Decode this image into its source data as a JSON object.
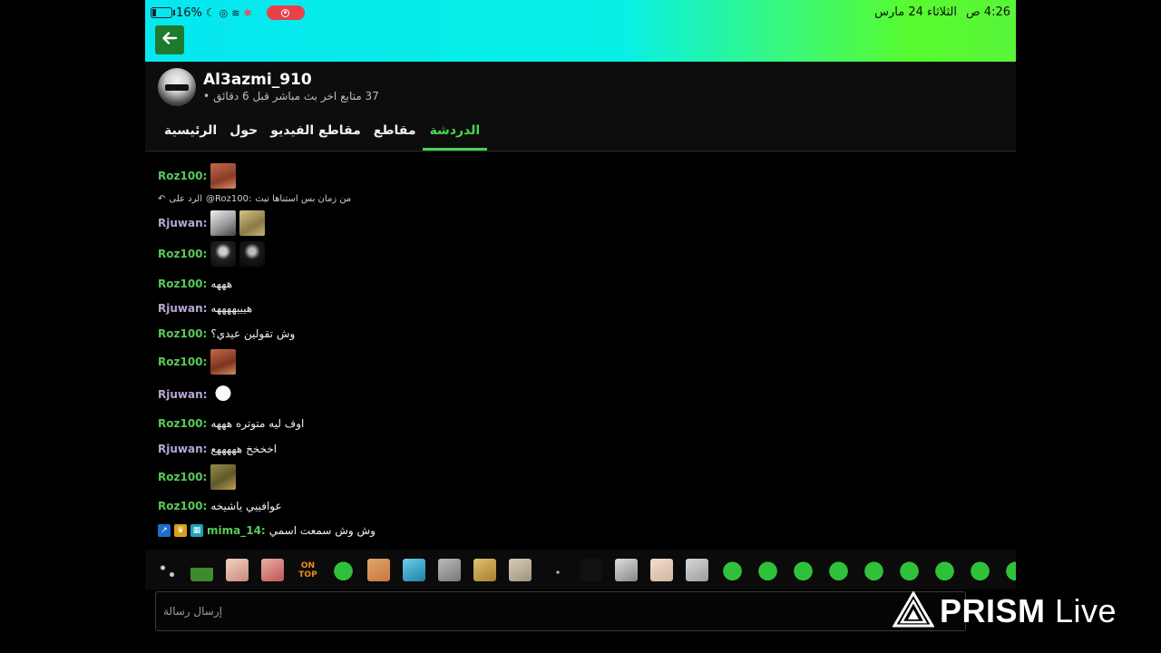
{
  "status": {
    "battery": "16%",
    "time": "4:26 ص",
    "date": "الثلاثاء 24 مارس"
  },
  "channel": {
    "name": "Al3azmi_910",
    "meta_followers": "37 متابع",
    "meta_last_live": "اخر بث مباشر قبل 6 دقائق",
    "meta_dot": "•"
  },
  "tabs": [
    "الرئيسية",
    "حول",
    "مقاطع الفيديو",
    "مقاطع",
    "الدردشة"
  ],
  "chat": {
    "reply_label": "الرد على",
    "reply_target": "@Roz100:",
    "reply_text": "من زمان بس استناها تبث",
    "messages": [
      {
        "nick": "Roz100:",
        "color": "green",
        "text": ""
      },
      {
        "nick": "Rjuwan:",
        "color": "purple",
        "text": ""
      },
      {
        "nick": "Roz100:",
        "color": "green",
        "text": ""
      },
      {
        "nick": "Roz100:",
        "color": "green",
        "text": "هههه"
      },
      {
        "nick": "Rjuwan:",
        "color": "purple",
        "text": "هيييههههه"
      },
      {
        "nick": "Roz100:",
        "color": "green",
        "text": "وش تقولين عيدي؟"
      },
      {
        "nick": "Roz100:",
        "color": "green",
        "text": ""
      },
      {
        "nick": "Rjuwan:",
        "color": "purple",
        "text": ""
      },
      {
        "nick": "Roz100:",
        "color": "green",
        "text": "اوف ليه متوتره هههه"
      },
      {
        "nick": "Rjuwan:",
        "color": "purple",
        "text": "اخخخخ هههههع"
      },
      {
        "nick": "Roz100:",
        "color": "green",
        "text": ""
      },
      {
        "nick": "Roz100:",
        "color": "green",
        "text": "عوافييي ياشيخه"
      },
      {
        "nick": "mima_14:",
        "color": "green",
        "text": "وش وش سمعت اسمي"
      }
    ]
  },
  "emote_bar": {
    "ontop_label": "ON TOP"
  },
  "input": {
    "placeholder": "إرسال رسالة"
  },
  "watermark": {
    "brand_bold": "PRISM",
    "brand_light": "Live"
  },
  "colors": {
    "accent_green": "#49d44f",
    "nick_green": "#59c95a",
    "nick_purple": "#b9a6d6"
  }
}
